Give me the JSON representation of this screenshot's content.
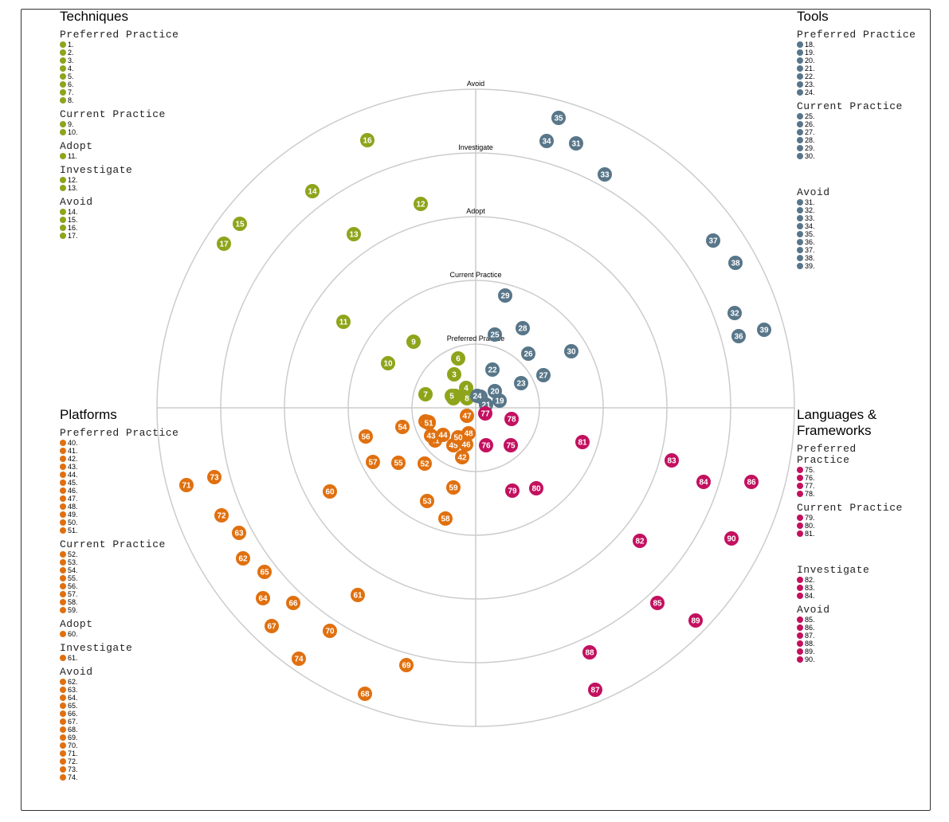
{
  "rings": [
    "Preferred Practice",
    "Current Practice",
    "Adopt",
    "Investigate",
    "Avoid"
  ],
  "colors": {
    "techniques": "#8ea41b",
    "tools": "#587689",
    "platforms": "#e0700f",
    "languages": "#c3105f",
    "grid": "#cccccc"
  },
  "quadrants": [
    {
      "key": "techniques",
      "title": "Techniques",
      "sections": [
        {
          "ring": "Preferred Practice",
          "items": [
            1,
            2,
            3,
            4,
            5,
            6,
            7,
            8
          ]
        },
        {
          "ring": "Current Practice",
          "items": [
            9,
            10
          ]
        },
        {
          "ring": "Adopt",
          "items": [
            11
          ]
        },
        {
          "ring": "Investigate",
          "items": [
            12,
            13
          ]
        },
        {
          "ring": "Avoid",
          "items": [
            14,
            15,
            16,
            17
          ]
        }
      ]
    },
    {
      "key": "tools",
      "title": "Tools",
      "sections": [
        {
          "ring": "Preferred Practice",
          "items": [
            18,
            19,
            20,
            21,
            22,
            23,
            24
          ]
        },
        {
          "ring": "Current Practice",
          "items": [
            25,
            26,
            27,
            28,
            29,
            30
          ]
        },
        {
          "ring": "Avoid",
          "items": [
            31,
            32,
            33,
            34,
            35,
            36,
            37,
            38,
            39
          ],
          "gap": true
        }
      ]
    },
    {
      "key": "platforms",
      "title": "Platforms",
      "sections": [
        {
          "ring": "Preferred Practice",
          "items": [
            40,
            41,
            42,
            43,
            44,
            45,
            46,
            47,
            48,
            49,
            50,
            51
          ]
        },
        {
          "ring": "Current Practice",
          "items": [
            52,
            53,
            54,
            55,
            56,
            57,
            58,
            59
          ]
        },
        {
          "ring": "Adopt",
          "items": [
            60
          ]
        },
        {
          "ring": "Investigate",
          "items": [
            61
          ]
        },
        {
          "ring": "Avoid",
          "items": [
            62,
            63,
            64,
            65,
            66,
            67,
            68,
            69,
            70,
            71,
            72,
            73,
            74
          ]
        }
      ]
    },
    {
      "key": "languages",
      "title": "Languages & Frameworks",
      "sections": [
        {
          "ring": "Preferred Practice",
          "items": [
            75,
            76,
            77,
            78
          ]
        },
        {
          "ring": "Current Practice",
          "items": [
            79,
            80,
            81
          ]
        },
        {
          "ring": "Investigate",
          "items": [
            82,
            83,
            84
          ],
          "gap": true
        },
        {
          "ring": "Avoid",
          "items": [
            85,
            86,
            87,
            88,
            89,
            90
          ]
        }
      ]
    }
  ]
}
